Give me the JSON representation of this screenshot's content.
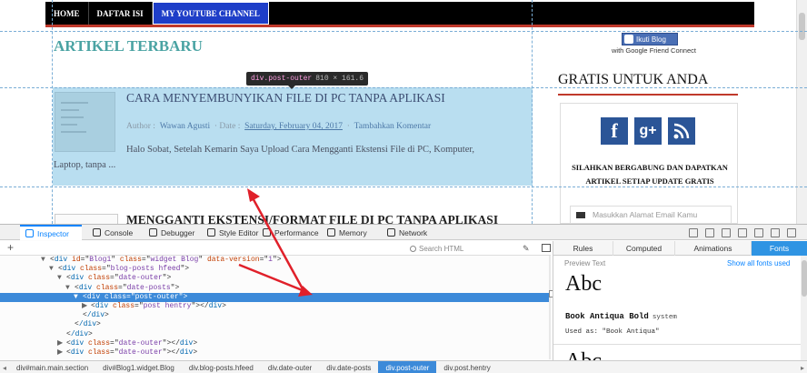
{
  "nav": {
    "items": [
      "HOME",
      "DAFTAR ISI",
      "MY YOUTUBE CHANNEL"
    ]
  },
  "content": {
    "section_title": "ARTIKEL TERBARU",
    "post1": {
      "title": "CARA MENYEMBUNYIKAN FILE DI PC TANPA APLIKASI",
      "author_label": "Author :",
      "author": "Wawan Agusti",
      "date_label": "Date :",
      "date": "Saturday, February 04, 2017",
      "comment": "Tambahkan Komentar",
      "snippet_1": "Halo Sobat, Setelah Kemarin Saya Upload Cara Mengganti Ekstensi File di PC, Komputer,",
      "snippet_2": "Laptop, tanpa ..."
    },
    "post2": {
      "title": "MENGGANTI EKSTENSI/FORMAT FILE DI PC TANPA APLIKASI"
    }
  },
  "sidebar": {
    "follow_label": "Ikuti Blog",
    "follow_sub": "with Google Friend Connect",
    "gratis_title": "GRATIS UNTUK ANDA",
    "social": [
      "f",
      "g+",
      "rss"
    ],
    "subscribe_text": "SILAHKAN BERGABUNG DAN DAPATKAN ARTIKEL SETIAP UPDATE GRATIS",
    "email_placeholder": "Masukkan Alamat Email Kamu"
  },
  "highlighter": {
    "selector": "div.post-outer",
    "dims": "810 × 161.6"
  },
  "devtools": {
    "tabs": [
      "Inspector",
      "Console",
      "Debugger",
      "Style Editor",
      "Performance",
      "Memory",
      "Network"
    ],
    "search_placeholder": "Search HTML",
    "plus": "+",
    "markup_lines": [
      {
        "indent": 5,
        "twisty": "▼",
        "tag": "div",
        "attrs": [
          [
            "id",
            "Blog1"
          ],
          [
            "class",
            "widget Blog"
          ],
          [
            "data-version",
            "1"
          ]
        ],
        "close": false,
        "selected": false
      },
      {
        "indent": 6,
        "twisty": "▼",
        "tag": "div",
        "attrs": [
          [
            "class",
            "blog-posts hfeed"
          ]
        ],
        "close": false,
        "selected": false
      },
      {
        "indent": 7,
        "twisty": "▼",
        "tag": "div",
        "attrs": [
          [
            "class",
            "date-outer"
          ]
        ],
        "close": false,
        "selected": false
      },
      {
        "indent": 8,
        "twisty": "▼",
        "tag": "div",
        "attrs": [
          [
            "class",
            "date-posts"
          ]
        ],
        "close": false,
        "selected": false
      },
      {
        "indent": 9,
        "twisty": "▼",
        "tag": "div",
        "attrs": [
          [
            "class",
            "post-outer"
          ]
        ],
        "close": false,
        "selected": true
      },
      {
        "indent": 10,
        "twisty": "▶",
        "tag": "div",
        "attrs": [
          [
            "class",
            "post hentry"
          ]
        ],
        "close": true,
        "selected": false
      },
      {
        "indent": 9,
        "twisty": "",
        "tag": "/div",
        "attrs": [],
        "close": false,
        "selected": false
      },
      {
        "indent": 8,
        "twisty": "",
        "tag": "/div",
        "attrs": [],
        "close": false,
        "selected": false
      },
      {
        "indent": 7,
        "twisty": "",
        "tag": "/div",
        "attrs": [],
        "close": false,
        "selected": false
      },
      {
        "indent": 7,
        "twisty": "▶",
        "tag": "div",
        "attrs": [
          [
            "class",
            "date-outer"
          ]
        ],
        "close": true,
        "selected": false
      },
      {
        "indent": 7,
        "twisty": "▶",
        "tag": "div",
        "attrs": [
          [
            "class",
            "date-outer"
          ]
        ],
        "close": true,
        "selected": false
      }
    ],
    "side_tabs": [
      "Rules",
      "Computed",
      "Animations",
      "Fonts"
    ],
    "preview_label": "Preview Text",
    "show_all": "Show all fonts used",
    "font_sample": "Abc",
    "font_name": "Book Antiqua Bold",
    "font_sys": "system",
    "used_as": "Used as: \"Book Antiqua\"",
    "breadcrumbs": [
      "div#main.main.section",
      "div#Blog1.widget.Blog",
      "div.blog-posts.hfeed",
      "div.date-outer",
      "div.date-posts",
      "div.post-outer",
      "div.post.hentry"
    ],
    "breadcrumb_active": 5
  },
  "colors": {
    "accent": "#0a84ff",
    "selection": "#3c8ad9",
    "highlight": "#b9def0",
    "annotation": "#e0202a"
  }
}
